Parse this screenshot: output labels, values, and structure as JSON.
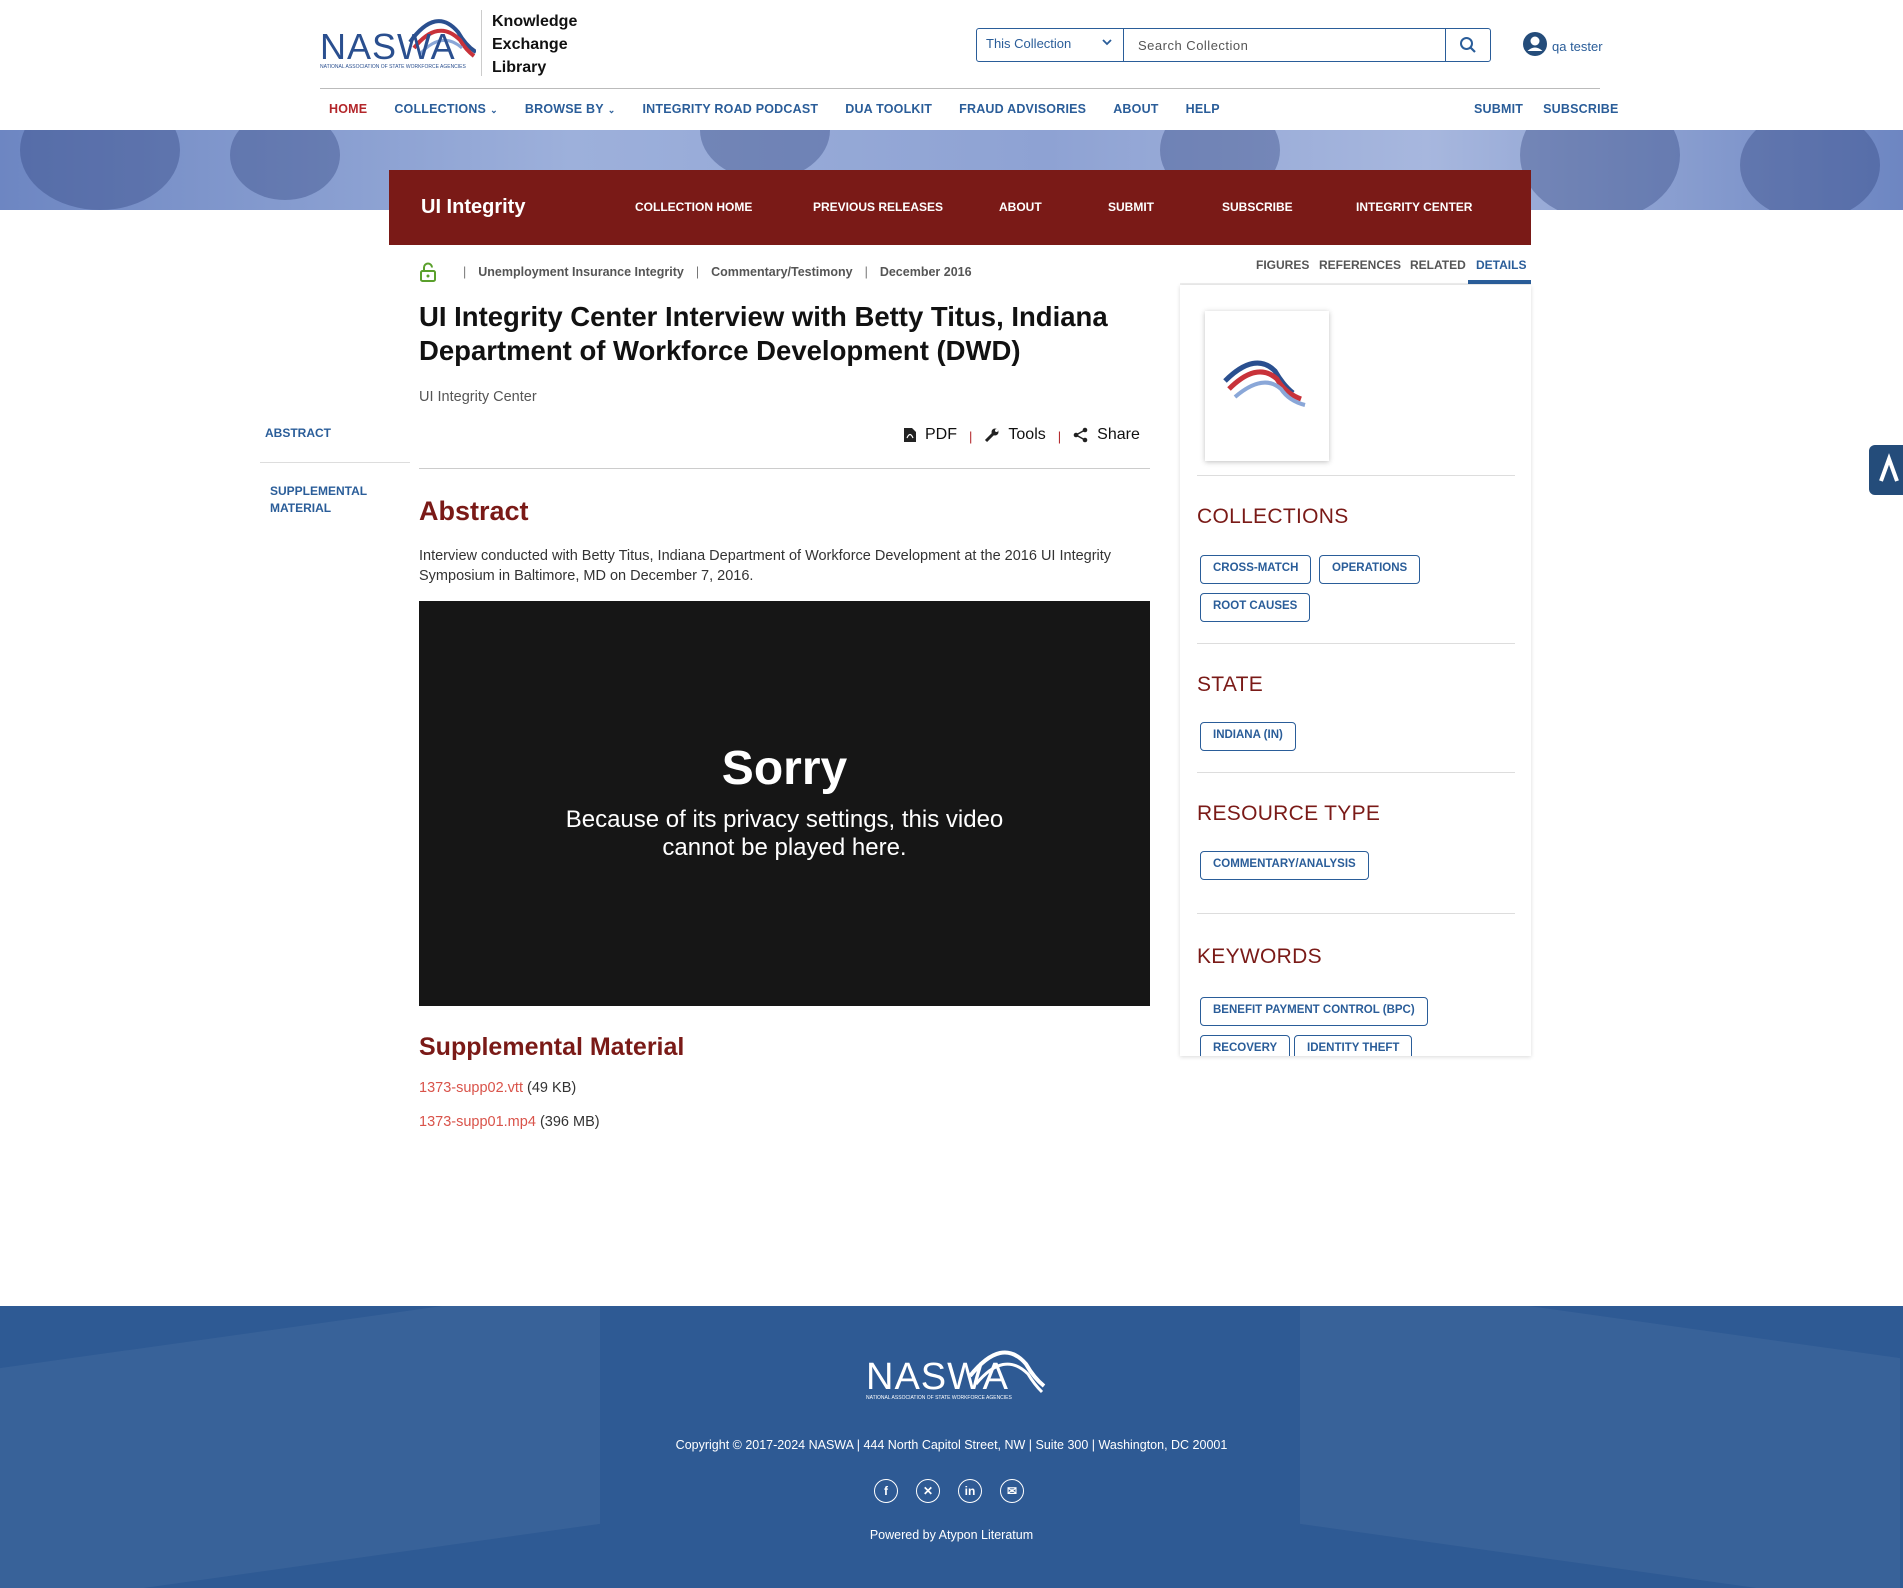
{
  "header": {
    "logo_text": "NASWA",
    "logo_subtext": "NATIONAL ASSOCIATION OF STATE WORKFORCE AGENCIES",
    "library_title": [
      "Knowledge",
      "Exchange",
      "Library"
    ],
    "search_scope": "This Collection",
    "search_placeholder": "Search Collection",
    "user_name": "qa tester",
    "nav": [
      {
        "label": "HOME",
        "active": true
      },
      {
        "label": "COLLECTIONS",
        "dropdown": true
      },
      {
        "label": "BROWSE BY",
        "dropdown": true
      },
      {
        "label": "INTEGRITY ROAD PODCAST"
      },
      {
        "label": "DUA TOOLKIT"
      },
      {
        "label": "FRAUD ADVISORIES"
      },
      {
        "label": "ABOUT"
      },
      {
        "label": "HELP"
      }
    ],
    "nav_right": [
      "SUBMIT",
      "SUBSCRIBE"
    ]
  },
  "collection": {
    "title": "UI Integrity",
    "nav": [
      "COLLECTION HOME",
      "PREVIOUS RELEASES",
      "ABOUT",
      "SUBMIT",
      "SUBSCRIBE",
      "INTEGRITY CENTER"
    ]
  },
  "toc": {
    "abstract": "ABSTRACT",
    "supplemental": "SUPPLEMENTAL MATERIAL"
  },
  "article": {
    "breadcrumbs": [
      "Unemployment Insurance Integrity",
      "Commentary/Testimony",
      "December 2016"
    ],
    "title": "UI Integrity Center Interview with Betty Titus, Indiana Department of Workforce Development (DWD)",
    "author": "UI Integrity Center",
    "tools": {
      "pdf": "PDF",
      "tools": "Tools",
      "share": "Share"
    },
    "abstract_heading": "Abstract",
    "abstract_text": "Interview conducted with Betty Titus, Indiana Department of Workforce Development at the 2016 UI Integrity Symposium in Baltimore, MD on December 7, 2016.",
    "video": {
      "heading": "Sorry",
      "message": "Because of its privacy settings, this video cannot be played here."
    },
    "supplemental_heading": "Supplemental Material",
    "files": [
      {
        "name": "1373-supp02.vtt",
        "size": "(49 KB)"
      },
      {
        "name": "1373-supp01.mp4",
        "size": "(396 MB)"
      }
    ]
  },
  "sidebar": {
    "tabs": [
      "FIGURES",
      "REFERENCES",
      "RELATED",
      "DETAILS"
    ],
    "active_tab": "DETAILS",
    "sections": {
      "collections": {
        "heading": "COLLECTIONS",
        "tags": [
          "CROSS-MATCH",
          "OPERATIONS",
          "ROOT CAUSES"
        ]
      },
      "state": {
        "heading": "STATE",
        "tags": [
          "INDIANA (IN)"
        ]
      },
      "resource_type": {
        "heading": "RESOURCE TYPE",
        "tags": [
          "COMMENTARY/ANALYSIS"
        ]
      },
      "keywords": {
        "heading": "KEYWORDS",
        "tags": [
          "BENEFIT PAYMENT CONTROL (BPC)",
          "RECOVERY",
          "IDENTITY THEFT"
        ]
      }
    }
  },
  "footer": {
    "logo_text": "NASWA",
    "logo_subtext": "NATIONAL ASSOCIATION OF STATE WORKFORCE AGENCIES",
    "copyright": "Copyright © 2017-2024 NASWA | 444 North Capitol Street, NW | Suite 300 | Washington, DC 20001",
    "social": [
      "facebook-icon",
      "x-icon",
      "linkedin-icon",
      "email-icon"
    ],
    "powered_by": "Powered by Atypon Literatum"
  },
  "colors": {
    "brand_blue": "#2a5d99",
    "brand_red": "#7a1a17",
    "accent_red": "#b3262a",
    "footer_blue": "#2e5a94"
  }
}
